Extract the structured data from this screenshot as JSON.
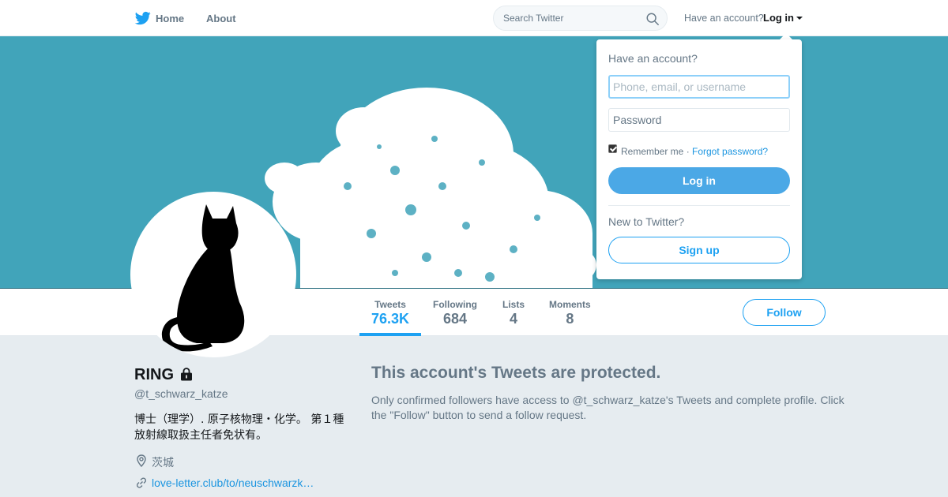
{
  "nav": {
    "home_label": "Home",
    "about_label": "About",
    "search_placeholder": "Search Twitter",
    "have_account": "Have an account?",
    "login_label": "Log in"
  },
  "profile_nav": {
    "stats": [
      {
        "label": "Tweets",
        "value": "76.3K",
        "active": true
      },
      {
        "label": "Following",
        "value": "684",
        "active": false
      },
      {
        "label": "Lists",
        "value": "4",
        "active": false
      },
      {
        "label": "Moments",
        "value": "8",
        "active": false
      }
    ],
    "follow_label": "Follow"
  },
  "profile": {
    "name": "RING",
    "handle": "@t_schwarz_katze",
    "bio": "博士（理学）. 原子核物理・化学。 第１種放射線取扱主任者免状有。",
    "location": "茨城",
    "link": "love-letter.club/to/neuschwarzk…"
  },
  "protected": {
    "title": "This account's Tweets are protected.",
    "body": "Only confirmed followers have access to @t_schwarz_katze's Tweets and complete profile. Click the \"Follow\" button to send a follow request."
  },
  "login_dropdown": {
    "title": "Have an account?",
    "username_placeholder": "Phone, email, or username",
    "password_placeholder": "Password",
    "remember_me": "Remember me ·",
    "remember_checked": true,
    "forgot_password": "Forgot password?",
    "login_button": "Log in",
    "new_to_twitter": "New to Twitter?",
    "signup_button": "Sign up"
  },
  "colors": {
    "brand": "#1da1f2",
    "banner": "#41a4ba",
    "background": "#e6ecf0"
  },
  "icons": [
    "twitter-bird-icon",
    "search-icon",
    "caret-down-icon",
    "lock-icon",
    "location-pin-icon",
    "link-icon"
  ]
}
